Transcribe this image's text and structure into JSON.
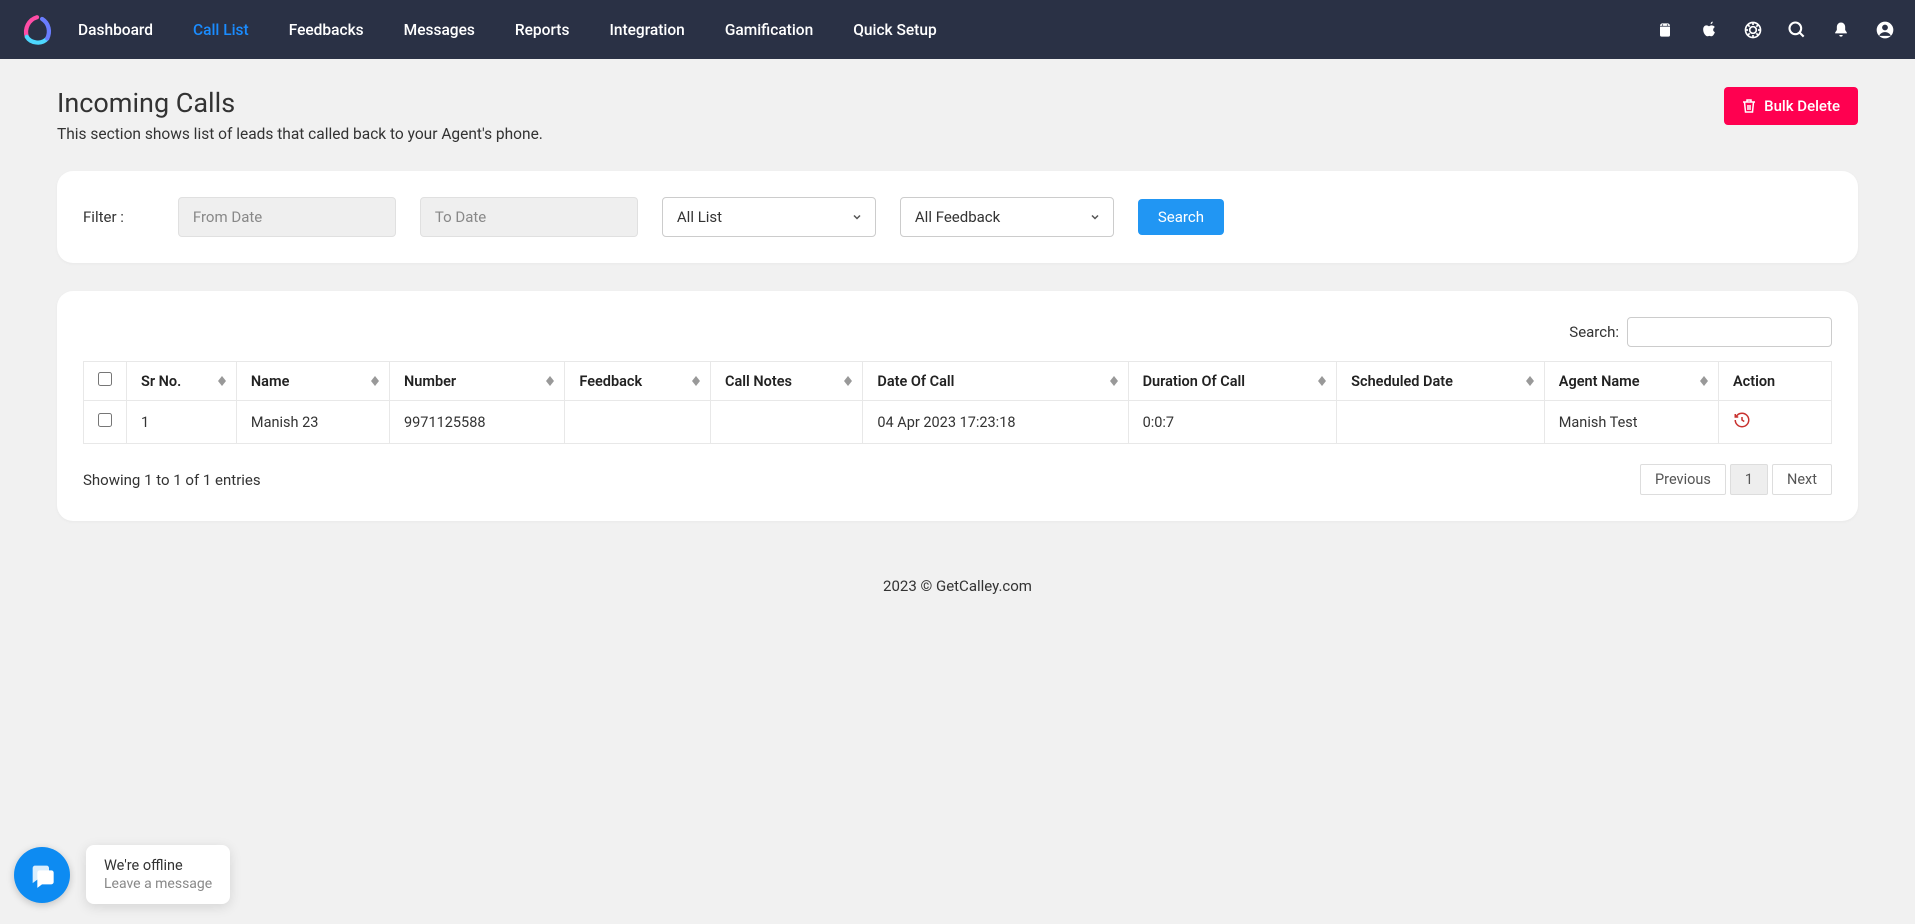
{
  "nav": {
    "items": [
      "Dashboard",
      "Call List",
      "Feedbacks",
      "Messages",
      "Reports",
      "Integration",
      "Gamification",
      "Quick Setup"
    ],
    "activeIndex": 1
  },
  "page": {
    "title": "Incoming Calls",
    "subtitle": "This section shows list of leads that called back to your Agent's phone."
  },
  "buttons": {
    "bulkDelete": "Bulk Delete",
    "search": "Search"
  },
  "filter": {
    "label": "Filter :",
    "fromPlaceholder": "From Date",
    "toPlaceholder": "To Date",
    "listSelect": "All List",
    "feedbackSelect": "All Feedback"
  },
  "table": {
    "searchLabel": "Search:",
    "headers": [
      "Sr No.",
      "Name",
      "Number",
      "Feedback",
      "Call Notes",
      "Date Of Call",
      "Duration Of Call",
      "Scheduled Date",
      "Agent Name",
      "Action"
    ],
    "rows": [
      {
        "srNo": "1",
        "name": "Manish 23",
        "number": "9971125588",
        "feedback": "",
        "callNotes": "",
        "dateOfCall": "04 Apr 2023 17:23:18",
        "duration": "0:0:7",
        "scheduledDate": "",
        "agentName": "Manish Test"
      }
    ],
    "info": "Showing 1 to 1 of 1 entries"
  },
  "pagination": {
    "prev": "Previous",
    "page": "1",
    "next": "Next"
  },
  "footer": "2023 © GetCalley.com",
  "chat": {
    "title": "We're offline",
    "subtitle": "Leave a message"
  }
}
